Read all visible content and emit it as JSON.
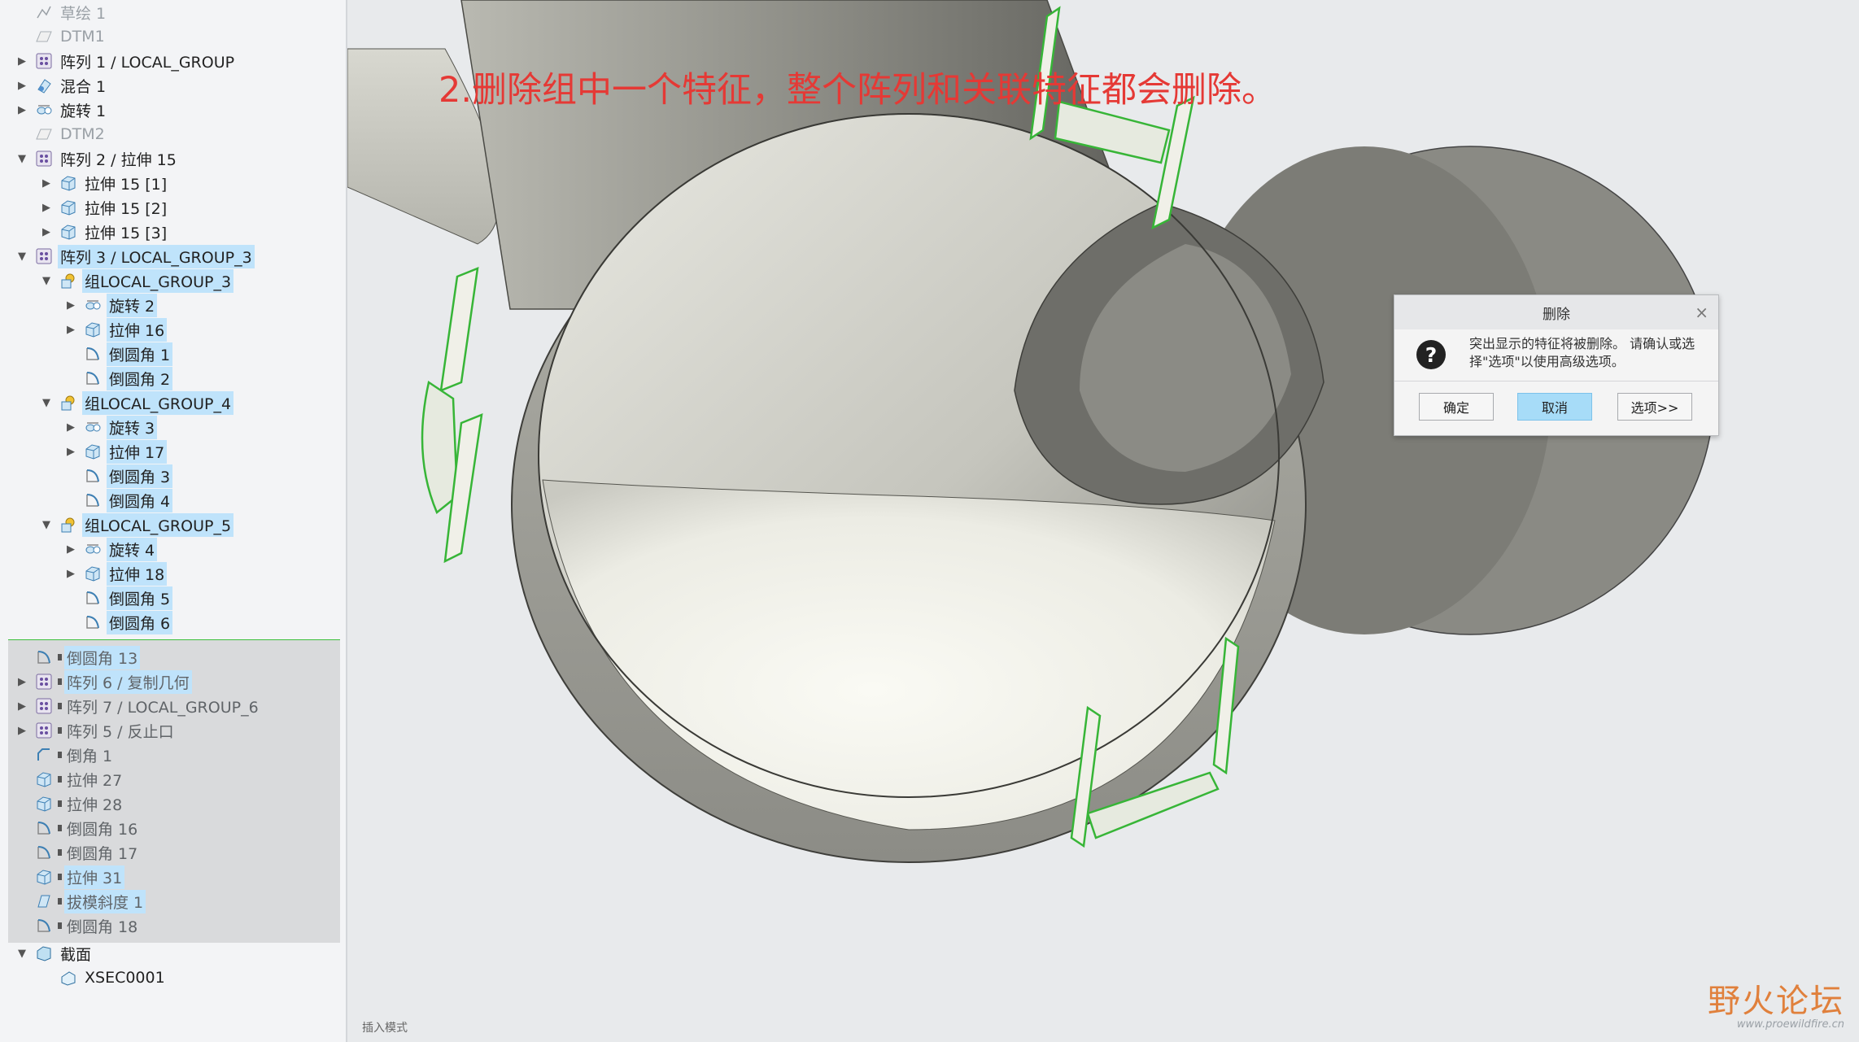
{
  "tree": {
    "items": [
      {
        "label": "草绘 1",
        "icon": "sketch-icon",
        "indent": 0,
        "expand": "none",
        "state": "dim",
        "selected": false
      },
      {
        "label": "DTM1",
        "icon": "datum-plane-icon",
        "indent": 0,
        "expand": "none",
        "state": "dim",
        "selected": false
      },
      {
        "label": "阵列 1 / LOCAL_GROUP",
        "icon": "pattern-icon",
        "indent": 0,
        "expand": "collapsed",
        "state": "normal",
        "selected": false
      },
      {
        "label": "混合 1",
        "icon": "blend-icon",
        "indent": 0,
        "expand": "collapsed",
        "state": "normal",
        "selected": false
      },
      {
        "label": "旋转 1",
        "icon": "revolve-icon",
        "indent": 0,
        "expand": "collapsed",
        "state": "normal",
        "selected": false
      },
      {
        "label": "DTM2",
        "icon": "datum-plane-icon",
        "indent": 0,
        "expand": "none",
        "state": "dim",
        "selected": false
      },
      {
        "label": "阵列 2 / 拉伸 15",
        "icon": "pattern-icon",
        "indent": 0,
        "expand": "expanded",
        "state": "normal",
        "selected": false
      },
      {
        "label": "拉伸 15 [1]",
        "icon": "extrude-icon",
        "indent": 1,
        "expand": "collapsed",
        "state": "normal",
        "selected": false
      },
      {
        "label": "拉伸 15 [2]",
        "icon": "extrude-icon",
        "indent": 1,
        "expand": "collapsed",
        "state": "normal",
        "selected": false
      },
      {
        "label": "拉伸 15 [3]",
        "icon": "extrude-icon",
        "indent": 1,
        "expand": "collapsed",
        "state": "normal",
        "selected": false
      },
      {
        "label": "阵列 3 / LOCAL_GROUP_3",
        "icon": "pattern-icon",
        "indent": 0,
        "expand": "expanded",
        "state": "normal",
        "selected": true
      },
      {
        "label": "组LOCAL_GROUP_3",
        "icon": "group-icon",
        "indent": 1,
        "expand": "expanded",
        "state": "normal",
        "selected": true
      },
      {
        "label": "旋转 2",
        "icon": "revolve-icon",
        "indent": 2,
        "expand": "collapsed",
        "state": "normal",
        "selected": true
      },
      {
        "label": "拉伸 16",
        "icon": "extrude-icon",
        "indent": 2,
        "expand": "collapsed",
        "state": "normal",
        "selected": true
      },
      {
        "label": "倒圆角 1",
        "icon": "round-icon",
        "indent": 2,
        "expand": "none",
        "state": "normal",
        "selected": true
      },
      {
        "label": "倒圆角 2",
        "icon": "round-icon",
        "indent": 2,
        "expand": "none",
        "state": "normal",
        "selected": true
      },
      {
        "label": "组LOCAL_GROUP_4",
        "icon": "group-icon",
        "indent": 1,
        "expand": "expanded",
        "state": "normal",
        "selected": true
      },
      {
        "label": "旋转 3",
        "icon": "revolve-icon",
        "indent": 2,
        "expand": "collapsed",
        "state": "normal",
        "selected": true
      },
      {
        "label": "拉伸 17",
        "icon": "extrude-icon",
        "indent": 2,
        "expand": "collapsed",
        "state": "normal",
        "selected": true
      },
      {
        "label": "倒圆角 3",
        "icon": "round-icon",
        "indent": 2,
        "expand": "none",
        "state": "normal",
        "selected": true
      },
      {
        "label": "倒圆角 4",
        "icon": "round-icon",
        "indent": 2,
        "expand": "none",
        "state": "normal",
        "selected": true
      },
      {
        "label": "组LOCAL_GROUP_5",
        "icon": "group-icon",
        "indent": 1,
        "expand": "expanded",
        "state": "normal",
        "selected": true
      },
      {
        "label": "旋转 4",
        "icon": "revolve-icon",
        "indent": 2,
        "expand": "collapsed",
        "state": "normal",
        "selected": true
      },
      {
        "label": "拉伸 18",
        "icon": "extrude-icon",
        "indent": 2,
        "expand": "collapsed",
        "state": "normal",
        "selected": true
      },
      {
        "label": "倒圆角 5",
        "icon": "round-icon",
        "indent": 2,
        "expand": "none",
        "state": "normal",
        "selected": true
      },
      {
        "label": "倒圆角 6",
        "icon": "round-icon",
        "indent": 2,
        "expand": "none",
        "state": "normal",
        "selected": true
      }
    ],
    "frozen_items": [
      {
        "label": "倒圆角 13",
        "icon": "round-icon",
        "expand": "none",
        "selected": true
      },
      {
        "label": "阵列 6 / 复制几何",
        "icon": "pattern-icon",
        "expand": "collapsed",
        "selected": true
      },
      {
        "label": "阵列 7 / LOCAL_GROUP_6",
        "icon": "pattern-icon",
        "expand": "collapsed",
        "selected": false
      },
      {
        "label": "阵列 5 / 反止口",
        "icon": "pattern-icon",
        "expand": "collapsed",
        "selected": false
      },
      {
        "label": "倒角 1",
        "icon": "chamfer-icon",
        "expand": "none",
        "selected": false
      },
      {
        "label": "拉伸 27",
        "icon": "extrude-icon",
        "expand": "none",
        "selected": false
      },
      {
        "label": "拉伸 28",
        "icon": "extrude-icon",
        "expand": "none",
        "selected": false
      },
      {
        "label": "倒圆角 16",
        "icon": "round-icon",
        "expand": "none",
        "selected": false
      },
      {
        "label": "倒圆角 17",
        "icon": "round-icon",
        "expand": "none",
        "selected": false
      },
      {
        "label": "拉伸 31",
        "icon": "extrude-icon",
        "expand": "none",
        "selected": true
      },
      {
        "label": "拔模斜度 1",
        "icon": "draft-icon",
        "expand": "none",
        "selected": true
      },
      {
        "label": "倒圆角 18",
        "icon": "round-icon",
        "expand": "none",
        "selected": false
      }
    ],
    "tail_items": [
      {
        "label": "截面",
        "icon": "section-icon",
        "indent": 0,
        "expand": "expanded",
        "selected": false
      },
      {
        "label": "XSEC0001",
        "icon": "xsec-icon",
        "indent": 1,
        "expand": "none",
        "selected": false
      }
    ]
  },
  "viewport": {
    "annotation": "2.删除组中一个特征，整个阵列和关联特征都会删除。",
    "status": "插入模式",
    "watermark_title": "野火论坛",
    "watermark_url": "www.proewildfire.cn"
  },
  "dialog": {
    "title": "删除",
    "message": "突出显示的特征将被删除。 请确认或选择\"选项\"以使用高级选项。",
    "ok_label": "确定",
    "cancel_label": "取消",
    "options_label": "选项>>"
  },
  "colors": {
    "selection": "#bfe3fb",
    "annotation": "#e53935",
    "highlight": "#3cbf3c",
    "cancel_button": "#a7dcf8"
  }
}
